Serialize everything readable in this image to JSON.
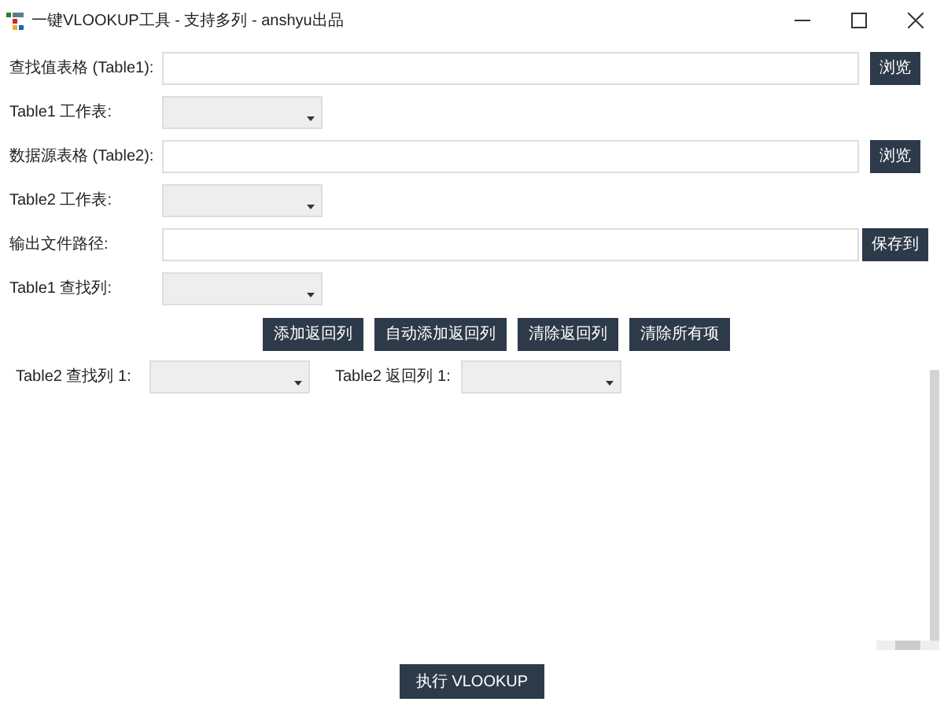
{
  "window": {
    "title": "一键VLOOKUP工具 - 支持多列 - anshyu出品"
  },
  "form": [
    {
      "kind": "file",
      "label": "查找值表格 (Table1):",
      "button": "浏览"
    },
    {
      "kind": "combo",
      "label": "Table1 工作表:"
    },
    {
      "kind": "file",
      "label": "数据源表格 (Table2):",
      "button": "浏览"
    },
    {
      "kind": "combo",
      "label": "Table2 工作表:"
    },
    {
      "kind": "file",
      "label": "输出文件路径:",
      "button": "保存到"
    },
    {
      "kind": "combo",
      "label": "Table1 查找列:"
    }
  ],
  "actions": [
    "添加返回列",
    "自动添加返回列",
    "清除返回列",
    "清除所有项"
  ],
  "column_pairs": [
    {
      "lookup_label": "Table2 查找列 1:",
      "return_label": "Table2 返回列 1:"
    }
  ],
  "run_button": "执行 VLOOKUP"
}
